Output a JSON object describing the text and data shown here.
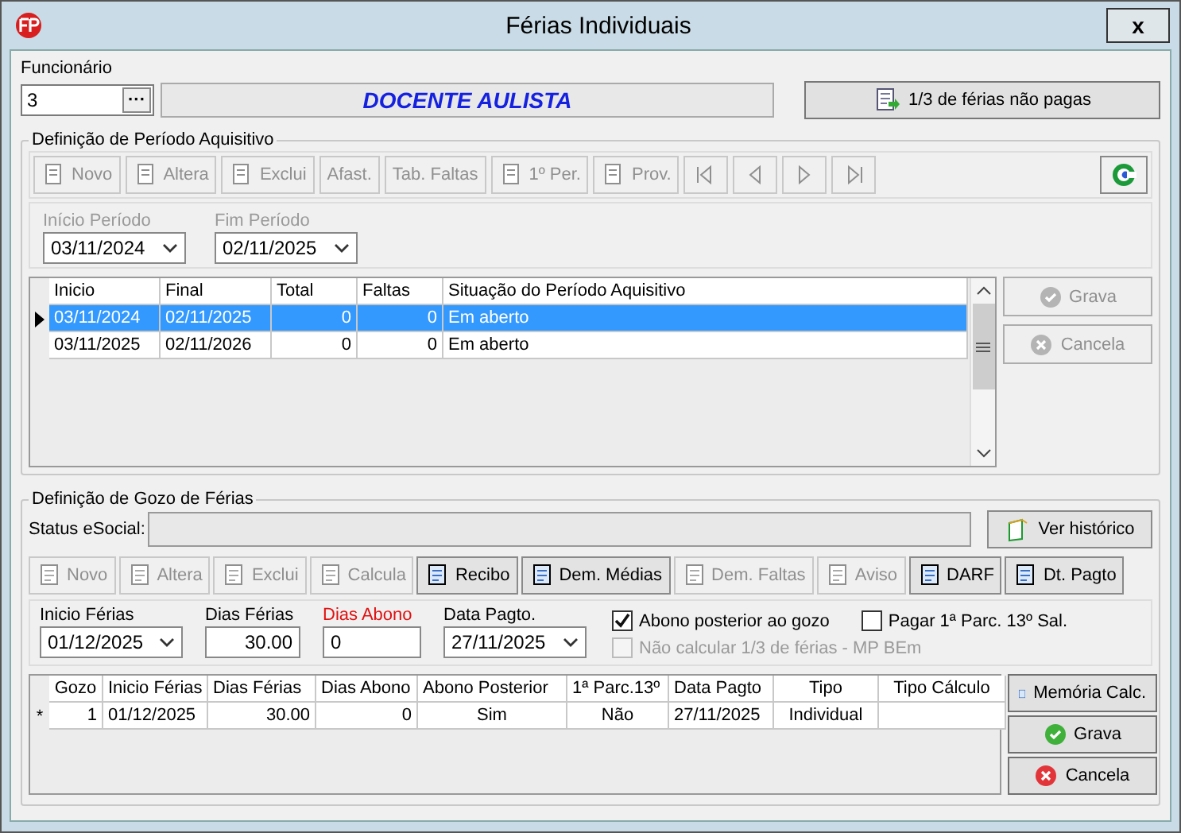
{
  "window": {
    "title": "Férias Individuais",
    "close": "x"
  },
  "funcionario": {
    "label": "Funcionário",
    "code": "3",
    "browse": "···",
    "name": "DOCENTE AULISTA",
    "button": "1/3 de férias não pagas"
  },
  "periodo": {
    "title": "Definição de Período Aquisitivo",
    "toolbar": [
      {
        "kind": "text",
        "label": "Novo",
        "disabled": true
      },
      {
        "kind": "text",
        "label": "Altera",
        "disabled": true
      },
      {
        "kind": "text",
        "label": "Exclui",
        "disabled": true
      },
      {
        "kind": "text",
        "label": "Afast.",
        "disabled": true
      },
      {
        "kind": "text",
        "label": "Tab. Faltas",
        "disabled": true
      },
      {
        "kind": "text",
        "label": "1º Per.",
        "disabled": true
      },
      {
        "kind": "text",
        "label": "Prov.",
        "disabled": true
      },
      {
        "kind": "nav",
        "disabled": true
      },
      {
        "kind": "nav",
        "disabled": true
      },
      {
        "kind": "nav",
        "disabled": true
      },
      {
        "kind": "nav",
        "disabled": true
      }
    ],
    "refresh": {
      "disabled": false
    },
    "fields": [
      {
        "label": "Início Período",
        "value": "03/11/2024",
        "disabled": true
      },
      {
        "label": "Fim Período",
        "value": "02/11/2025",
        "disabled": true
      }
    ],
    "table": {
      "columns": [
        "Inicio",
        "Final",
        "Total",
        "Faltas",
        "Situação do Período Aquisitivo"
      ],
      "rows": [
        {
          "selected": true,
          "cells": [
            "03/11/2024",
            "02/11/2025",
            "0",
            "0",
            "Em aberto"
          ]
        },
        {
          "selected": false,
          "cells": [
            "03/11/2025",
            "02/11/2026",
            "0",
            "0",
            "Em aberto"
          ]
        }
      ]
    },
    "buttons": [
      {
        "label": "Grava",
        "kind": "ok",
        "disabled": true
      },
      {
        "label": "Cancela",
        "kind": "cancel",
        "disabled": true
      }
    ]
  },
  "gozo": {
    "title": "Definição de Gozo de Férias",
    "status_label": "Status eSocial:",
    "history_button": "Ver histórico",
    "toolbar": [
      {
        "label": "Novo",
        "disabled": true
      },
      {
        "label": "Altera",
        "disabled": true
      },
      {
        "label": "Exclui",
        "disabled": true
      },
      {
        "label": "Calcula",
        "disabled": true
      },
      {
        "label": "Recibo",
        "disabled": false
      },
      {
        "label": "Dem. Médias",
        "disabled": false
      },
      {
        "label": "Dem. Faltas",
        "disabled": true
      },
      {
        "label": "Aviso",
        "disabled": true
      },
      {
        "label": "DARF",
        "disabled": false
      },
      {
        "label": "Dt. Pagto",
        "disabled": false
      }
    ],
    "fields": [
      {
        "kind": "select",
        "label": "Inicio Férias",
        "value": "01/12/2025",
        "highlighted": false
      },
      {
        "kind": "number",
        "label": "Dias Férias",
        "value": "30.00",
        "highlighted": false
      },
      {
        "kind": "text",
        "label": "Dias Abono",
        "value": "0",
        "highlighted": true
      },
      {
        "kind": "select",
        "label": "Data Pagto.",
        "value": "27/11/2025",
        "highlighted": false
      }
    ],
    "checkboxes": [
      {
        "label": "Abono posterior ao gozo",
        "checked": true,
        "disabled": false
      },
      {
        "label": "Pagar 1ª Parc. 13º Sal.",
        "checked": false,
        "disabled": false
      },
      {
        "label": "Não calcular 1/3 de férias - MP BEm",
        "checked": false,
        "disabled": true
      }
    ],
    "table": {
      "columns": [
        "Gozo",
        "Inicio Férias",
        "Dias Férias",
        "Dias Abono",
        "Abono Posterior",
        "1ª Parc.13º",
        "Data Pagto",
        "Tipo",
        "Tipo Cálculo"
      ],
      "rows": [
        {
          "marker": "*",
          "cells": [
            "1",
            "01/12/2025",
            "30.00",
            "0",
            "Sim",
            "Não",
            "27/11/2025",
            "Individual",
            ""
          ]
        }
      ]
    },
    "buttons": [
      {
        "label": "Memória Calc.",
        "kind": "doc",
        "disabled": false
      },
      {
        "label": "Grava",
        "kind": "ok",
        "disabled": false
      },
      {
        "label": "Cancela",
        "kind": "cancel",
        "disabled": false
      }
    ]
  }
}
